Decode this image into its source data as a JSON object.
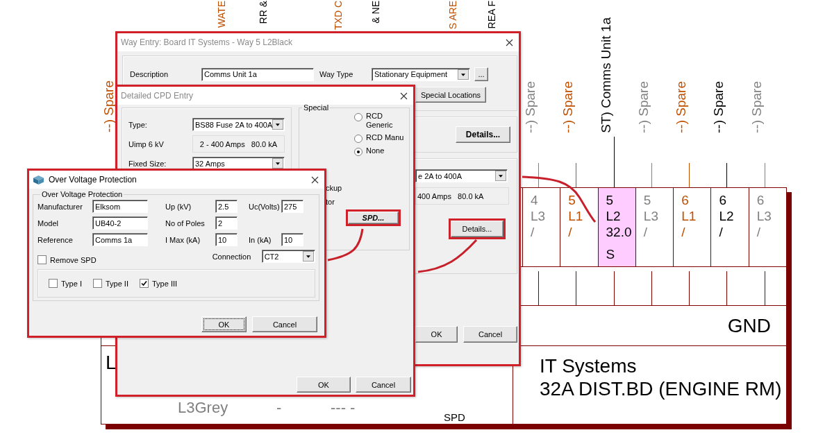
{
  "schematic": {
    "top_labels": [
      {
        "text": "WATE",
        "color": "#c05000"
      },
      {
        "text": "RR &",
        "color": "#000000"
      },
      {
        "text": "TXD C",
        "color": "#c05000"
      },
      {
        "text": "& NE",
        "color": "#000000"
      },
      {
        "text": "S ARE",
        "color": "#c05000"
      },
      {
        "text": "REA F",
        "color": "#000000"
      }
    ],
    "left_label": {
      "text": "--) Spare",
      "color": "#c05000"
    },
    "ways": [
      {
        "label": "--) Spare",
        "number": "4",
        "phase": "L3",
        "rating": "/",
        "selected": false,
        "color": "#808080"
      },
      {
        "label": "--) Spare",
        "number": "5",
        "phase": "L1",
        "rating": "/",
        "selected": false,
        "color": "#c05000"
      },
      {
        "label": "ST) Comms Unit 1a",
        "number": "5",
        "phase": "L2",
        "rating": "32.0",
        "code": "S",
        "selected": true,
        "color": "#000000"
      },
      {
        "label": "--) Spare",
        "number": "5",
        "phase": "L3",
        "rating": "/",
        "selected": false,
        "color": "#808080"
      },
      {
        "label": "--) Spare",
        "number": "6",
        "phase": "L1",
        "rating": "/",
        "selected": false,
        "color": "#c05000"
      },
      {
        "label": "--) Spare",
        "number": "6",
        "phase": "L2",
        "rating": "/",
        "selected": false,
        "color": "#000000"
      },
      {
        "label": "--) Spare",
        "number": "6",
        "phase": "L3",
        "rating": "/",
        "selected": false,
        "color": "#808080"
      }
    ],
    "earth_label": "GND",
    "board_name": "IT Systems",
    "board_description": "32A DIST.BD (ENGINE RM)",
    "phase_row": {
      "prefix": "L",
      "phase": "L3Grey",
      "column_2": "-",
      "column_3": "--- -"
    },
    "spd_label": "SPD"
  },
  "way_entry_dialog": {
    "title": "Way Entry: Board IT Systems - Way 5 L2Black",
    "description_label": "Description",
    "description": "Comms Unit 1a",
    "way_type_label": "Way Type",
    "way_type": "Stationary Equipment",
    "browse_button": "...",
    "special_locations_button": "Special Locations",
    "details_button": "Details...",
    "device_type": "e 2A to 400A",
    "device_range": "400 Amps   80.0 kA",
    "device_details_button": "Details...",
    "ok_button": "OK",
    "cancel_button": "Cancel"
  },
  "cpd_dialog": {
    "title": "Detailed CPD Entry",
    "type_label": "Type:",
    "type": "BS88 Fuse 2A to 400A",
    "uimp_label": "Uimp 6 kV",
    "range": "2 - 400 Amps   80.0 kA",
    "fixed_size_label": "Fixed Size:",
    "fixed_size": "32 Amps",
    "special_title": "Special",
    "special_options": [
      {
        "label": "RCD Generic",
        "selected": false
      },
      {
        "label": "RCD Manu",
        "selected": false
      },
      {
        "label": "None",
        "selected": true
      }
    ],
    "partial_labels": [
      "ckup",
      "tor"
    ],
    "spd_button": "SPD...",
    "ok_button": "OK",
    "cancel_button": "Cancel"
  },
  "ovp_dialog": {
    "title": "Over Voltage Protection",
    "group_title": "Over Voltage Protection",
    "rows": [
      {
        "fields": [
          {
            "label": "Manufacturer",
            "value": "Elksom"
          },
          {
            "label": "Up (kV)",
            "value": "2.5"
          },
          {
            "label": "Uc(Volts)",
            "value": "275"
          }
        ]
      },
      {
        "fields": [
          {
            "label": "Model",
            "value": "UB40-2"
          },
          {
            "label": "No of  Poles",
            "value": "2"
          }
        ]
      },
      {
        "fields": [
          {
            "label": "Reference",
            "value": "Comms 1a"
          },
          {
            "label": "I Max (kA)",
            "value": "10"
          },
          {
            "label": "In (kA)",
            "value": "10"
          }
        ]
      }
    ],
    "remove_spd": {
      "label": "Remove SPD",
      "checked": false
    },
    "connection_label": "Connection",
    "connection": "CT2",
    "types": [
      {
        "label": "Type I",
        "checked": false
      },
      {
        "label": "Type II",
        "checked": false
      },
      {
        "label": "Type III",
        "checked": true
      }
    ],
    "ok_button": "OK",
    "cancel_button": "Cancel"
  }
}
